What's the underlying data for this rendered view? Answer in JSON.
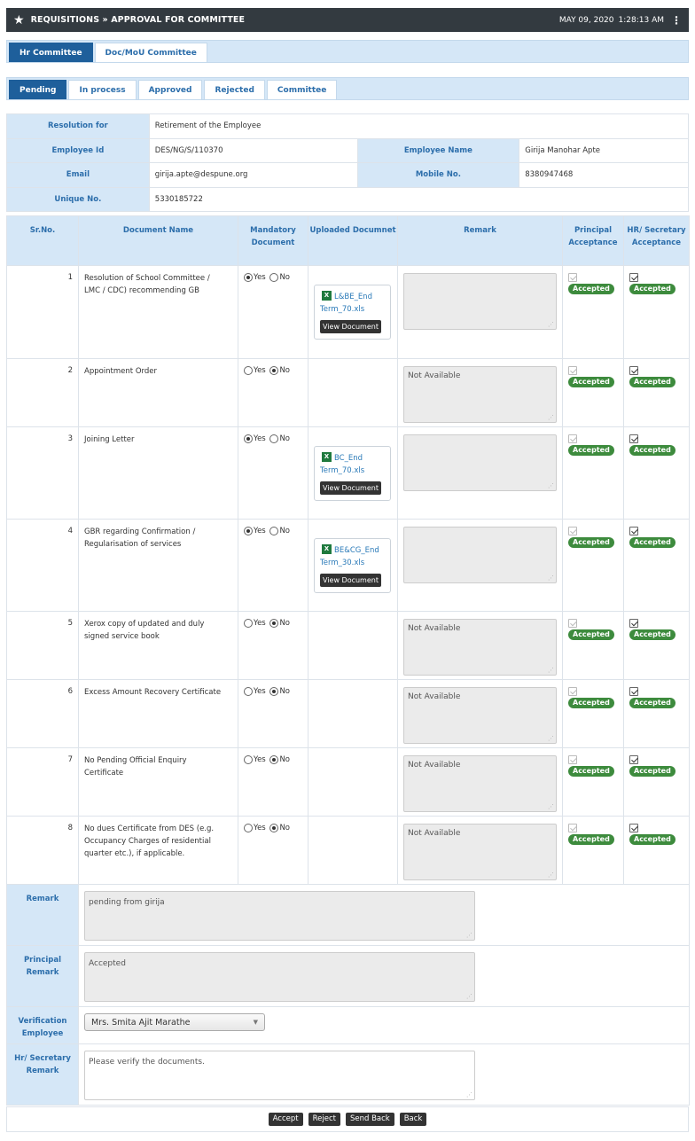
{
  "header": {
    "title": "REQUISITIONS » APPROVAL FOR COMMITTEE",
    "date": "MAY 09, 2020",
    "time": "1:28:13 AM"
  },
  "committee_tabs": [
    {
      "label": "Hr Committee",
      "active": true
    },
    {
      "label": "Doc/MoU Committee",
      "active": false
    }
  ],
  "status_tabs": [
    {
      "label": "Pending",
      "active": true
    },
    {
      "label": "In process",
      "active": false
    },
    {
      "label": "Approved",
      "active": false
    },
    {
      "label": "Rejected",
      "active": false
    },
    {
      "label": "Committee",
      "active": false
    }
  ],
  "info": {
    "resolution_label": "Resolution for",
    "resolution_value": "Retirement of the Employee",
    "emp_id_label": "Employee Id",
    "emp_id_value": "DES/NG/S/110370",
    "emp_name_label": "Employee Name",
    "emp_name_value": "Girija Manohar Apte",
    "email_label": "Email",
    "email_value": "girija.apte@despune.org",
    "mobile_label": "Mobile No.",
    "mobile_value": "8380947468",
    "unique_label": "Unique No.",
    "unique_value": "5330185722"
  },
  "table": {
    "headers": [
      "Sr.No.",
      "Document Name",
      "Mandatory Document",
      "Uploaded Documnet",
      "Remark",
      "Principal Acceptance",
      "HR/ Secretary Acceptance"
    ],
    "yes_label": "Yes",
    "no_label": "No",
    "view_label": "View Document",
    "accepted_label": "Accepted",
    "rows": [
      {
        "sr": "1",
        "name": "Resolution of School Committee / LMC / CDC) recommending GB",
        "mandatory": "yes",
        "file": "L&BE_End Term_70.xls",
        "remark": ""
      },
      {
        "sr": "2",
        "name": "Appointment Order",
        "mandatory": "no",
        "file": "",
        "remark": "Not Available"
      },
      {
        "sr": "3",
        "name": "Joining Letter",
        "mandatory": "yes",
        "file": "BC_End Term_70.xls",
        "remark": ""
      },
      {
        "sr": "4",
        "name": "GBR regarding Confirmation / Regularisation of services",
        "mandatory": "yes",
        "file": "BE&CG_End Term_30.xls",
        "remark": ""
      },
      {
        "sr": "5",
        "name": "Xerox copy of updated and duly signed service book",
        "mandatory": "no",
        "file": "",
        "remark": "Not Available"
      },
      {
        "sr": "6",
        "name": "Excess Amount Recovery Certificate",
        "mandatory": "no",
        "file": "",
        "remark": "Not Available"
      },
      {
        "sr": "7",
        "name": "No Pending Official Enquiry Certificate",
        "mandatory": "no",
        "file": "",
        "remark": "Not Available"
      },
      {
        "sr": "8",
        "name": "No dues Certificate from DES (e.g. Occupancy Charges of residential quarter etc.), if applicable.",
        "mandatory": "no",
        "file": "",
        "remark": "Not Available"
      }
    ]
  },
  "bottom": {
    "remark_label": "Remark",
    "remark_value": "pending from girija",
    "principal_label": "Principal Remark",
    "principal_value": "Accepted",
    "verification_label": "Verification Employee",
    "verification_value": "Mrs. Smita Ajit Marathe",
    "hr_label": "Hr/ Secretary Remark",
    "hr_value": "Please verify the documents."
  },
  "actions": [
    "Accept",
    "Reject",
    "Send Back",
    "Back"
  ]
}
